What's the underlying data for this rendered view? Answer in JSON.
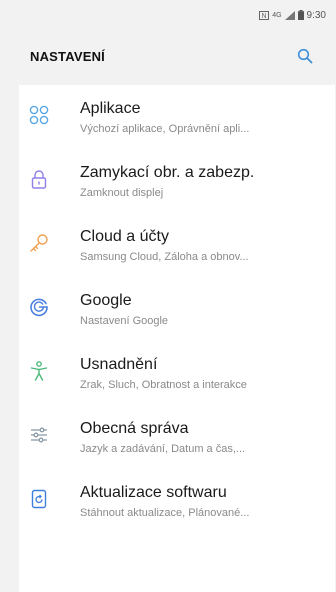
{
  "status": {
    "time": "9:30",
    "network": "4G"
  },
  "header": {
    "title": "NASTAVENÍ"
  },
  "accent_color": "#3e8fd8",
  "items": [
    {
      "label": "Aplikace",
      "sub": "Výchozí aplikace, Oprávnění apli...",
      "icon": "apps-grid-icon",
      "color": "#5aa7e6"
    },
    {
      "label": "Zamykací obr. a zabezp.",
      "sub": "Zamknout displej",
      "icon": "lock-icon",
      "color": "#8f7fe8"
    },
    {
      "label": "Cloud a účty",
      "sub": "Samsung Cloud, Záloha a obnov...",
      "icon": "key-icon",
      "color": "#f0a050"
    },
    {
      "label": "Google",
      "sub": "Nastavení Google",
      "icon": "google-icon",
      "color": "#4a7fe0"
    },
    {
      "label": "Usnadnění",
      "sub": "Zrak, Sluch, Obratnost a interakce",
      "icon": "accessibility-icon",
      "color": "#4cba7a"
    },
    {
      "label": "Obecná správa",
      "sub": "Jazyk a zadávání, Datum a čas,...",
      "icon": "sliders-icon",
      "color": "#8a9aa8"
    },
    {
      "label": "Aktualizace softwaru",
      "sub": "Stáhnout aktualizace, Plánované...",
      "icon": "software-update-icon",
      "color": "#3e7fe0"
    }
  ]
}
